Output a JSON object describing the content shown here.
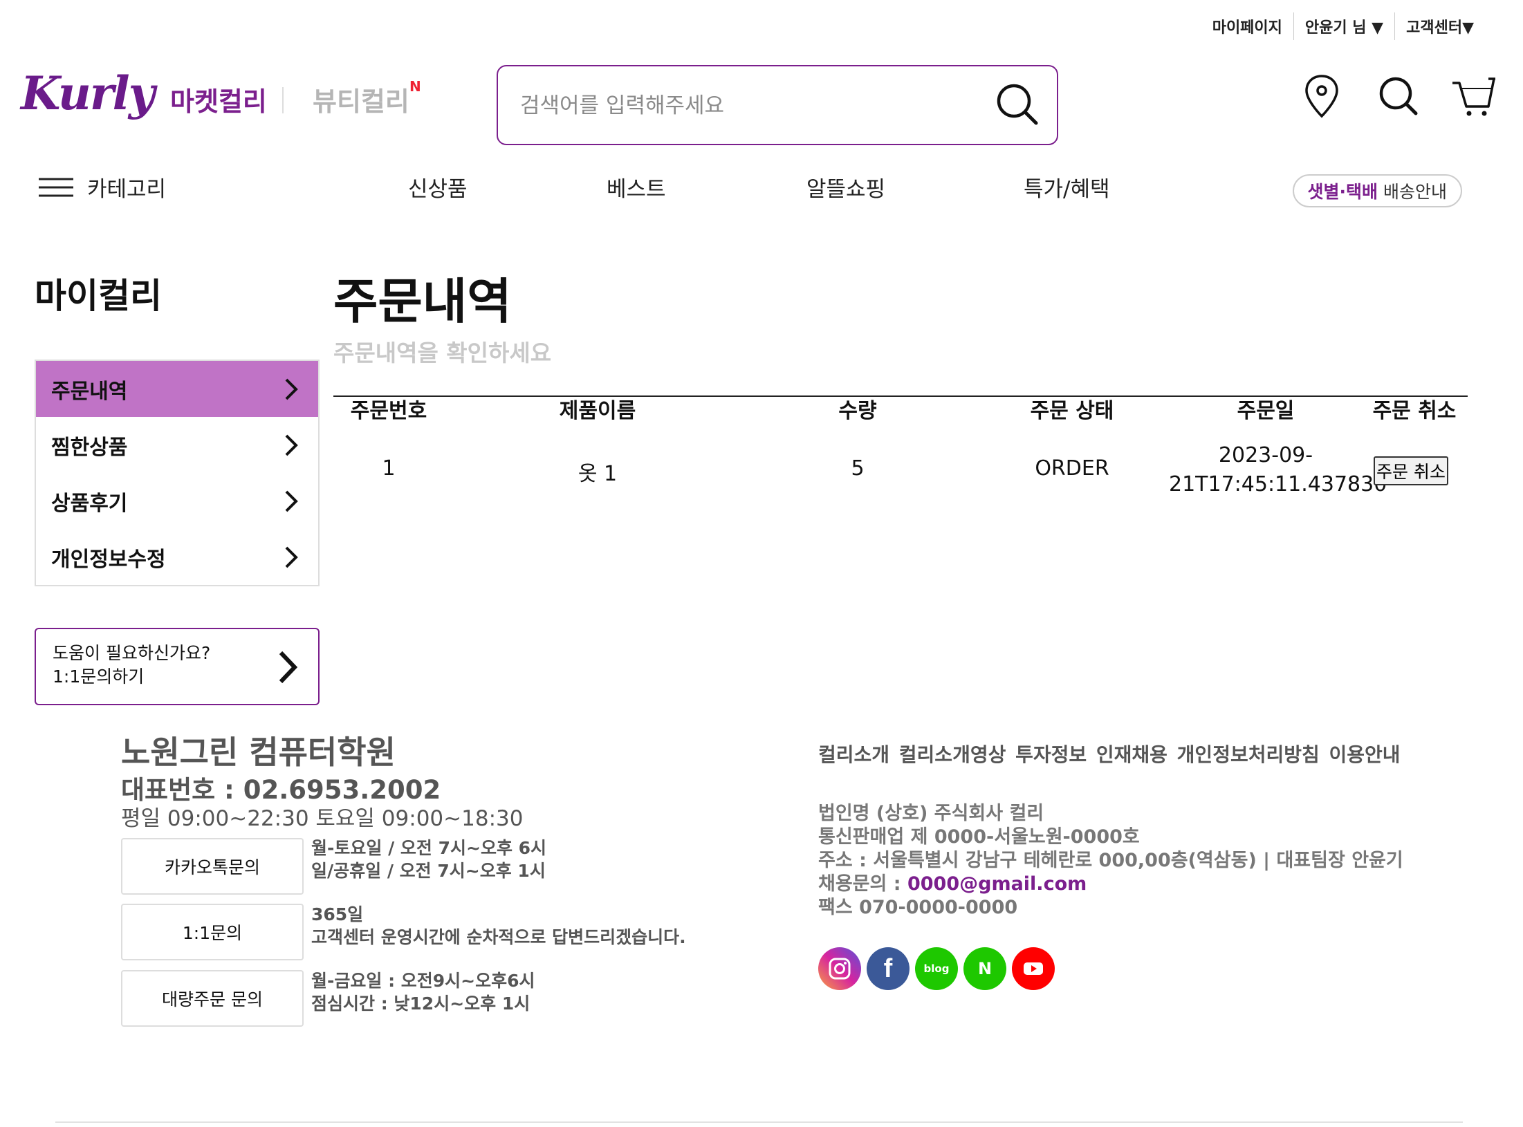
{
  "top_links": [
    "마이페이지",
    "안윤기 님 ▼",
    "고객센터▼"
  ],
  "header": {
    "logo": "Kurly",
    "market_label": "마켓컬리",
    "beauty_label": "뷰티컬리",
    "beauty_badge": "N",
    "search_placeholder": "검색어를 입력해주세요",
    "icons": [
      "location-pin-icon",
      "search-icon",
      "cart-icon"
    ]
  },
  "nav": {
    "category_label": "카테고리",
    "items": [
      "신상품",
      "베스트",
      "알뜰쇼핑",
      "특가/혜택"
    ],
    "delivery_highlight": "샛별·택배",
    "delivery_rest": " 배송안내"
  },
  "sidebar": {
    "title": "마이컬리",
    "items": [
      "주문내역",
      "찜한상품",
      "상품후기",
      "개인정보수정"
    ],
    "active_index": 0,
    "help_line1": "도움이 필요하신가요?",
    "help_line2": "1:1문의하기"
  },
  "main": {
    "title": "주문내역",
    "subtitle": "주문내역을 확인하세요",
    "columns": [
      "주문번호",
      "제품이름",
      "수량",
      "주문 상태",
      "주문일",
      "주문 취소"
    ],
    "rows": [
      {
        "order_no": "1",
        "product": "옷 1",
        "qty": "5",
        "status": "ORDER",
        "date_line1": "2023-09-",
        "date_line2": "21T17:45:11.437830",
        "cancel_label": "주문 취소"
      }
    ]
  },
  "footer": {
    "org": "노원그린 컴퓨터학원",
    "phone": "대표번호 : 02.6953.2002",
    "hours": "평일 09:00~22:30 토요일 09:00~18:30",
    "contacts": [
      {
        "button": "카카오톡문의",
        "line1": "월-토요일 / 오전 7시~오후 6시",
        "line2": "일/공휴일 / 오전 7시~오후 1시"
      },
      {
        "button": "1:1문의",
        "line1": "365일",
        "line2": "고객센터 운영시간에 순차적으로 답변드리겠습니다."
      },
      {
        "button": "대량주문 문의",
        "line1": "월-금요일 : 오전9시~오후6시",
        "line2": "점심시간 : 낮12시~오후 1시"
      }
    ],
    "links": "컬리소개 컬리소개영상 투자정보 인재채용 개인정보처리방침 이용안내",
    "company": "법인명 (상호) 주식회사 컬리",
    "license": "통신판매업 제 0000-서울노원-0000호",
    "address": "주소 : 서울특별시 강남구 테헤란로 000,00층(역삼동) | 대표팀장 안윤기",
    "recruit_label": "채용문의 : ",
    "recruit_email": "0000@gmail.com",
    "fax": "팩스 070-0000-0000",
    "social": [
      {
        "name": "instagram-icon",
        "color": "#d6249f"
      },
      {
        "name": "facebook-icon",
        "color": "#3b5998",
        "glyph": "f"
      },
      {
        "name": "blog-icon",
        "color": "#1ec800",
        "glyph": "blog"
      },
      {
        "name": "naver-post-icon",
        "color": "#1ec800",
        "glyph": "N"
      },
      {
        "name": "youtube-icon",
        "color": "#ff0000"
      }
    ]
  },
  "colors": {
    "brand": "#7b1f8d",
    "active_menu": "#c073c6"
  }
}
